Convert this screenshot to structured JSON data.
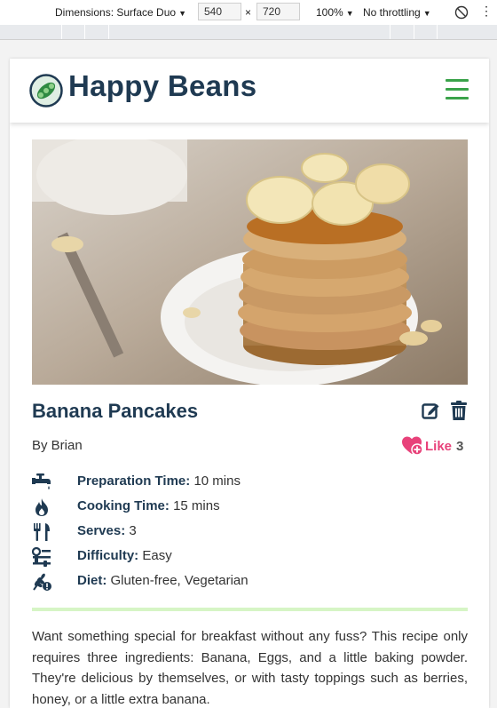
{
  "devtools": {
    "dimensions_label": "Dimensions: Surface Duo",
    "width": "540",
    "times": "×",
    "height": "720",
    "zoom": "100%",
    "throttling": "No throttling"
  },
  "brand": {
    "name": "Happy Beans",
    "primary_color": "#1f3a52",
    "accent_color": "#3aa34a"
  },
  "recipe": {
    "title": "Banana Pancakes",
    "author": "By Brian",
    "like_label": "Like",
    "like_count": "3",
    "facts": [
      {
        "icon": "faucet-icon",
        "label": "Preparation Time:",
        "value": "10 mins"
      },
      {
        "icon": "flame-icon",
        "label": "Cooking Time:",
        "value": "15 mins"
      },
      {
        "icon": "utensils-icon",
        "label": "Serves:",
        "value": "3"
      },
      {
        "icon": "sliders-icon",
        "label": "Difficulty:",
        "value": "Easy"
      },
      {
        "icon": "wheat-alert-icon",
        "label": "Diet:",
        "value": "Gluten-free, Vegetarian"
      }
    ],
    "description": "Want something special for breakfast without any fuss? This recipe only requires three ingredients: Banana, Eggs, and a little baking powder. They're delicious by themselves, or with tasty toppings such as berries, honey, or a little extra banana."
  }
}
